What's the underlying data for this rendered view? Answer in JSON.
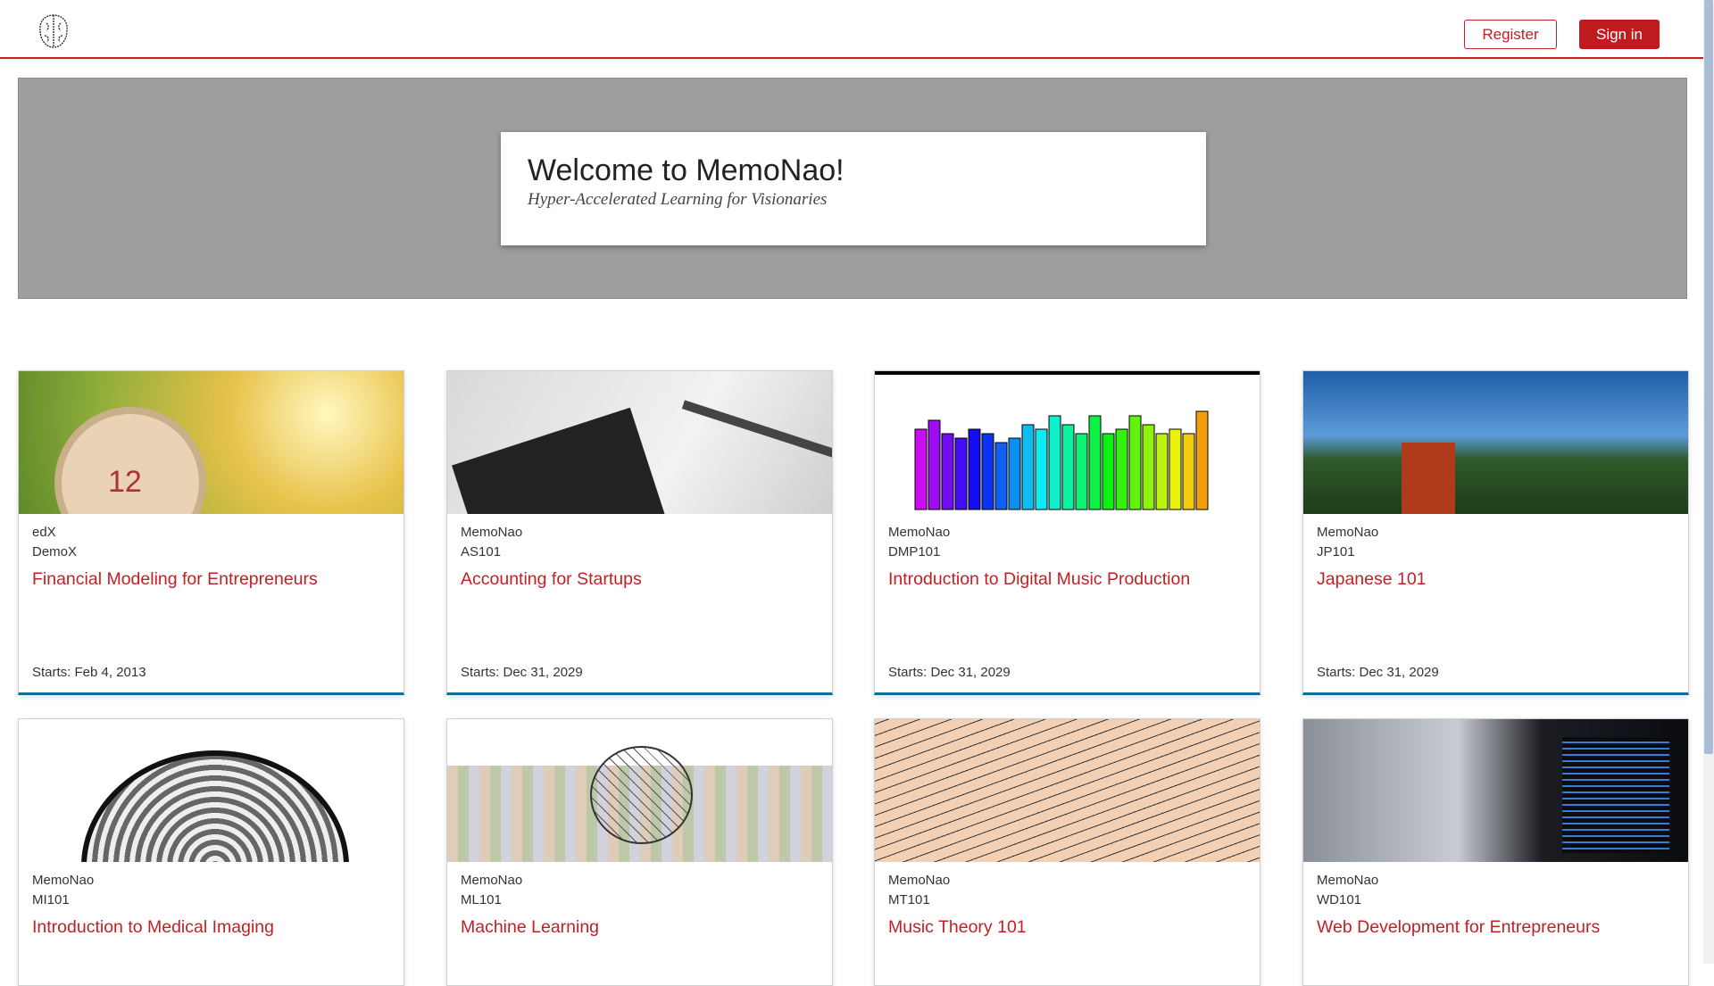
{
  "header": {
    "logo": "brain-icon",
    "register_label": "Register",
    "signin_label": "Sign in"
  },
  "hero": {
    "title": "Welcome to MemoNao!",
    "subtitle": "Hyper-Accelerated Learning for Visionaries"
  },
  "colors": {
    "accent": "#c32025",
    "card_border": "#126f9a",
    "hero_bg": "#9e9e9e"
  },
  "courses": [
    {
      "org": "edX",
      "code": "DemoX",
      "title": "Financial Modeling for Entrepreneurs",
      "starts": "Starts: Feb 4, 2013",
      "image": "alarm-clock"
    },
    {
      "org": "MemoNao",
      "code": "AS101",
      "title": "Accounting for Startups",
      "starts": "Starts: Dec 31, 2029",
      "image": "calculator-pen"
    },
    {
      "org": "MemoNao",
      "code": "DMP101",
      "title": "Introduction to Digital Music Production",
      "starts": "Starts: Dec 31, 2029",
      "image": "equalizer"
    },
    {
      "org": "MemoNao",
      "code": "JP101",
      "title": "Japanese 101",
      "starts": "Starts: Dec 31, 2029",
      "image": "pagoda"
    },
    {
      "org": "MemoNao",
      "code": "MI101",
      "title": "Introduction to Medical Imaging",
      "image": "brain-scan"
    },
    {
      "org": "MemoNao",
      "code": "ML101",
      "title": "Machine Learning",
      "image": "network-head"
    },
    {
      "org": "MemoNao",
      "code": "MT101",
      "title": "Music Theory 101",
      "image": "sheet-music"
    },
    {
      "org": "MemoNao",
      "code": "WD101",
      "title": "Web Development for Entrepreneurs",
      "image": "code-screen"
    }
  ]
}
